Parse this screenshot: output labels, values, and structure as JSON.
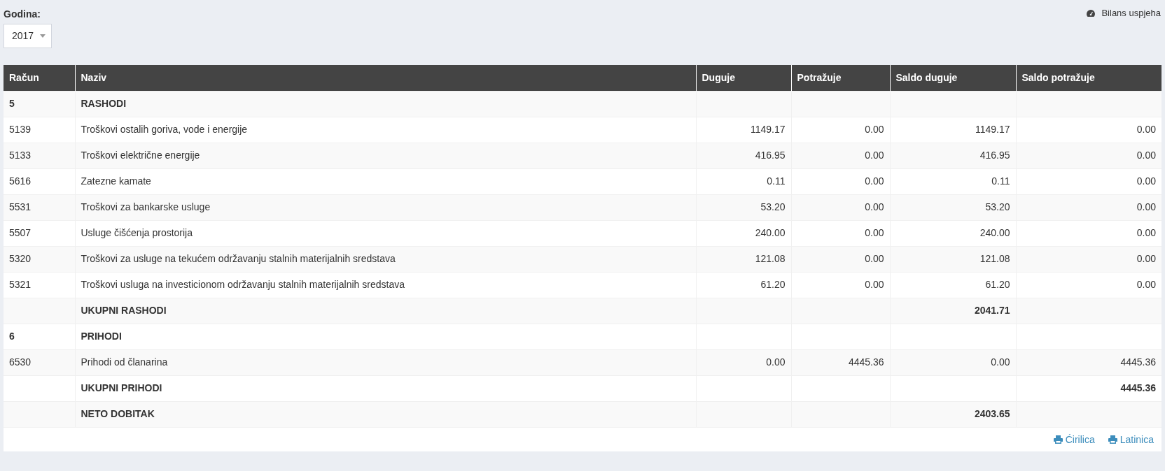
{
  "year_filter": {
    "label": "Godina:",
    "value": "2017"
  },
  "breadcrumb": {
    "label": "Bilans uspjeha"
  },
  "table": {
    "columns": [
      "Račun",
      "Naziv",
      "Duguje",
      "Potražuje",
      "Saldo duguje",
      "Saldo potražuje"
    ],
    "rows": [
      {
        "kind": "group",
        "account": "5",
        "name": "RASHODI"
      },
      {
        "kind": "item",
        "account": "5139",
        "name": "Troškovi ostalih goriva, vode i energije",
        "debit": "1149.17",
        "credit": "0.00",
        "balance_debit": "1149.17",
        "balance_credit": "0.00"
      },
      {
        "kind": "item",
        "account": "5133",
        "name": "Troškovi električne energije",
        "debit": "416.95",
        "credit": "0.00",
        "balance_debit": "416.95",
        "balance_credit": "0.00"
      },
      {
        "kind": "item",
        "account": "5616",
        "name": "Zatezne kamate",
        "debit": "0.11",
        "credit": "0.00",
        "balance_debit": "0.11",
        "balance_credit": "0.00"
      },
      {
        "kind": "item",
        "account": "5531",
        "name": "Troškovi za bankarske usluge",
        "debit": "53.20",
        "credit": "0.00",
        "balance_debit": "53.20",
        "balance_credit": "0.00"
      },
      {
        "kind": "item",
        "account": "5507",
        "name": "Usluge čišćenja prostorija",
        "debit": "240.00",
        "credit": "0.00",
        "balance_debit": "240.00",
        "balance_credit": "0.00"
      },
      {
        "kind": "item",
        "account": "5320",
        "name": "Troškovi za usluge na tekućem održavanju stalnih materijalnih sredstava",
        "debit": "121.08",
        "credit": "0.00",
        "balance_debit": "121.08",
        "balance_credit": "0.00"
      },
      {
        "kind": "item",
        "account": "5321",
        "name": "Troškovi usluga na investicionom održavanju stalnih materijalnih sredstava",
        "debit": "61.20",
        "credit": "0.00",
        "balance_debit": "61.20",
        "balance_credit": "0.00"
      },
      {
        "kind": "total",
        "name": "UKUPNI RASHODI",
        "balance_debit": "2041.71"
      },
      {
        "kind": "group",
        "account": "6",
        "name": "PRIHODI"
      },
      {
        "kind": "item",
        "account": "6530",
        "name": "Prihodi od članarina",
        "debit": "0.00",
        "credit": "4445.36",
        "balance_debit": "0.00",
        "balance_credit": "4445.36"
      },
      {
        "kind": "total",
        "name": "UKUPNI PRIHODI",
        "balance_credit": "4445.36"
      },
      {
        "kind": "total",
        "name": "NETO DOBITAK",
        "balance_debit": "2403.65"
      }
    ]
  },
  "print_links": [
    {
      "label": "Ćirilica"
    },
    {
      "label": "Latinica"
    }
  ]
}
